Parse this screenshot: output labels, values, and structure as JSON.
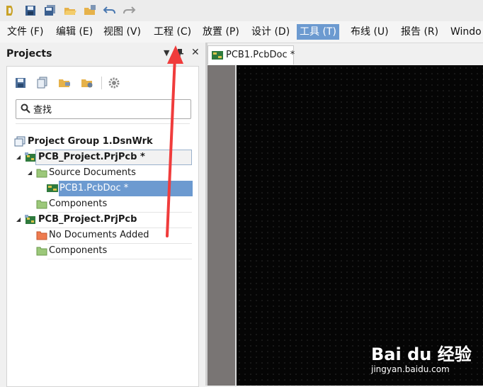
{
  "menu": {
    "file": "文件 (F)",
    "edit": "编辑 (E)",
    "view": "视图 (V)",
    "project": "工程 (C)",
    "place": "放置 (P)",
    "design": "设计 (D)",
    "tools": "工具 (T)",
    "route": "布线 (U)",
    "reports": "报告 (R)",
    "window": "Windo"
  },
  "panel": {
    "title": "Projects",
    "search_value": "查找",
    "tree": {
      "group": "Project Group 1.DsnWrk",
      "project1": "PCB_Project.PrjPcb *",
      "source_docs": "Source Documents",
      "pcb_doc": "PCB1.PcbDoc *",
      "components1": "Components",
      "project2": "PCB_Project.PrjPcb",
      "no_docs": "No Documents Added",
      "components2": "Components"
    }
  },
  "document": {
    "tab_label": "PCB1.PcbDoc *"
  },
  "watermark": {
    "logo": "Bai du 经验",
    "url": "jingyan.baidu.com"
  },
  "colors": {
    "menu_active": "#6c9ad0",
    "selection": "#6c9ad0",
    "board_bg": "#050505",
    "annotation_arrow": "#f03c3c"
  },
  "icons": [
    "app-logo-icon",
    "save-icon",
    "save-all-icon",
    "open-icon",
    "open-project-icon",
    "undo-icon",
    "redo-icon",
    "folder-icon",
    "pcb-icon",
    "search-icon",
    "gear-icon"
  ]
}
